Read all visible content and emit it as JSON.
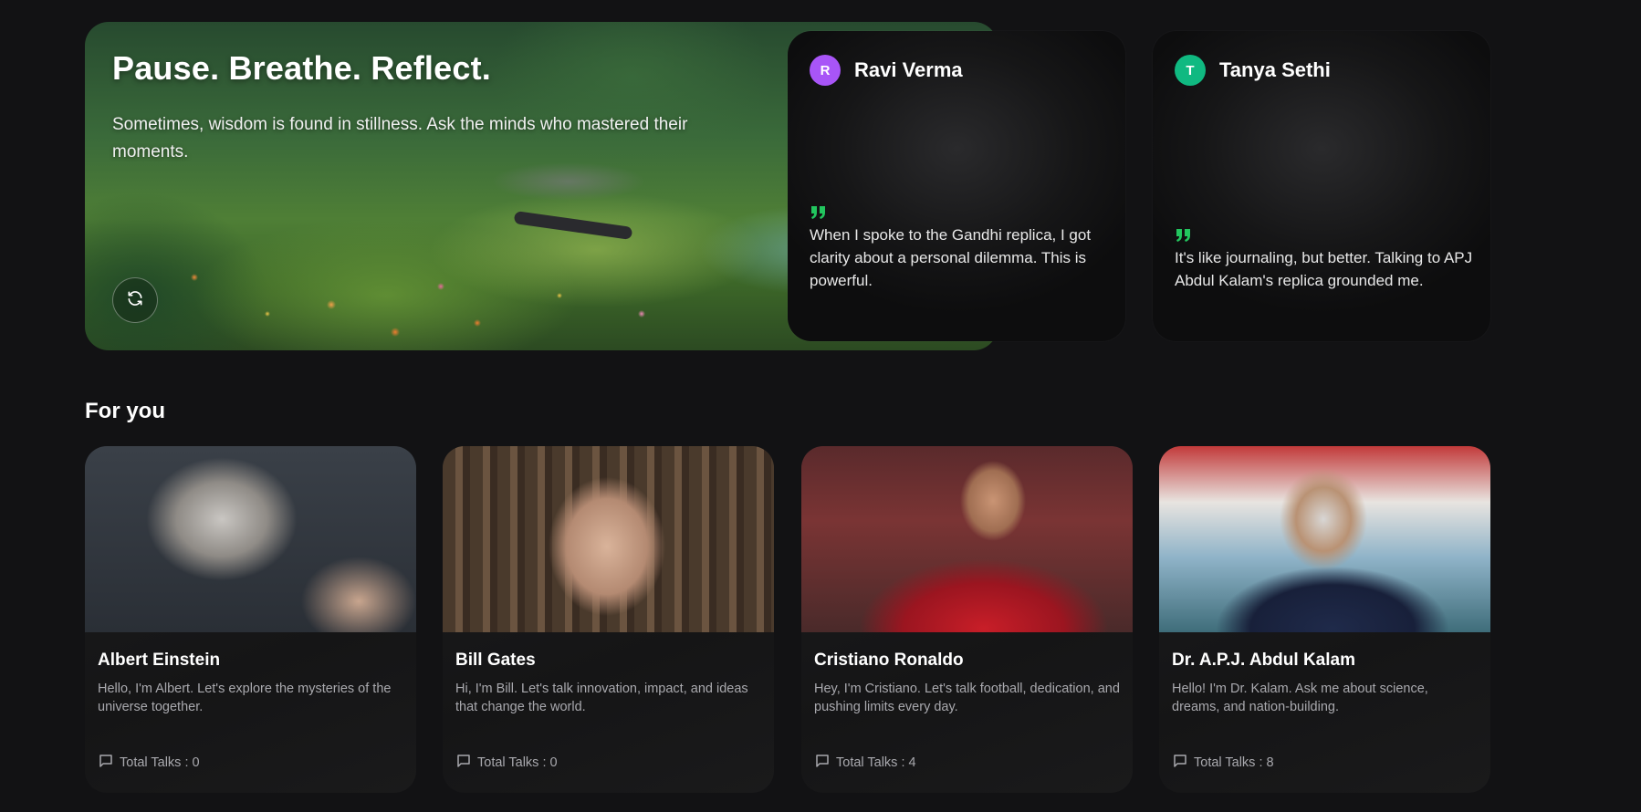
{
  "hero": {
    "title": "Pause. Breathe. Reflect.",
    "subtitle": "Sometimes, wisdom is found in stillness. Ask the minds who mastered their moments.",
    "refresh_icon": "refresh-icon"
  },
  "testimonials": [
    {
      "initial": "R",
      "name": "Ravi Verma",
      "avatar_color": "#a855f7",
      "quote": "When I spoke to the Gandhi replica, I got clarity about a personal dilemma. This is powerful."
    },
    {
      "initial": "T",
      "name": "Tanya Sethi",
      "avatar_color": "#10b981",
      "quote": "It's like journaling, but better. Talking to APJ Abdul Kalam's replica grounded me."
    }
  ],
  "accent_color": "#22c55e",
  "section": {
    "title": "For you"
  },
  "personas": [
    {
      "name": "Albert Einstein",
      "description": "Hello, I'm Albert. Let's explore the mysteries of the universe together.",
      "talks": "Total Talks : 0"
    },
    {
      "name": "Bill Gates",
      "description": "Hi, I'm Bill. Let's talk innovation, impact, and ideas that change the world.",
      "talks": "Total Talks : 0"
    },
    {
      "name": "Cristiano Ronaldo",
      "description": "Hey, I'm Cristiano. Let's talk football, dedication, and pushing limits every day.",
      "talks": "Total Talks : 4"
    },
    {
      "name": "Dr. A.P.J. Abdul Kalam",
      "description": "Hello! I'm Dr. Kalam. Ask me about science, dreams, and nation-building.",
      "talks": "Total Talks : 8"
    }
  ]
}
